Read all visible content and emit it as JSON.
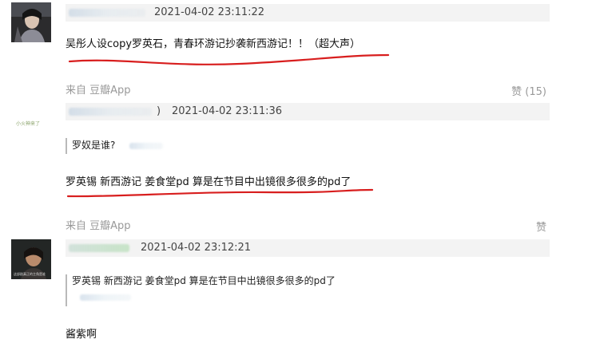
{
  "comments": [
    {
      "timestamp": "2021-04-02 23:11:22",
      "text": "吴彤人设copy罗英石，青春环游记抄袭新西游记！！（超大声）",
      "source": "来自 豆瓣App",
      "likes": "赞 (15)"
    },
    {
      "timestamp_prefix": ")",
      "timestamp": "2021-04-02 23:11:36",
      "avatar_label": "小火神来了",
      "quote": "罗奴是谁?",
      "text": "罗英锡 新西游记 姜食堂pd 算是在节目中出镜很多很多的pd了",
      "source": "来自 豆瓣App",
      "likes": "赞"
    },
    {
      "timestamp": "2021-04-02 23:12:21",
      "avatar_caption": "这部剧真正的主角是谁",
      "quote": "罗英锡 新西游记 姜食堂pd 算是在节目中出镜很多很多的pd了",
      "text": "酱紫啊"
    }
  ],
  "colors": {
    "underline": "#d81e1e",
    "header_bg": "#f3f3f3",
    "meta_text": "#999999"
  }
}
